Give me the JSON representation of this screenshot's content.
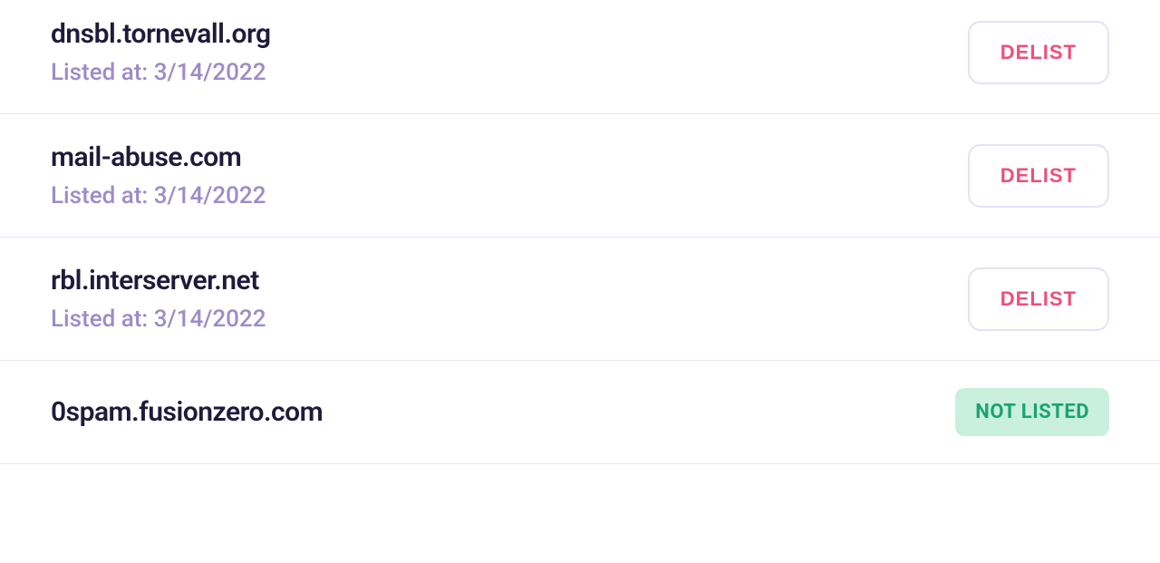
{
  "listed_at_prefix": "Listed at: ",
  "delist_label": "DELIST",
  "not_listed_label": "NOT LISTED",
  "items": [
    {
      "domain": "dnsbl.tornevall.org",
      "date": "3/14/2022",
      "listed": true
    },
    {
      "domain": "mail-abuse.com",
      "date": "3/14/2022",
      "listed": true
    },
    {
      "domain": "rbl.interserver.net",
      "date": "3/14/2022",
      "listed": true
    },
    {
      "domain": "0spam.fusionzero.com",
      "date": "",
      "listed": false
    }
  ]
}
